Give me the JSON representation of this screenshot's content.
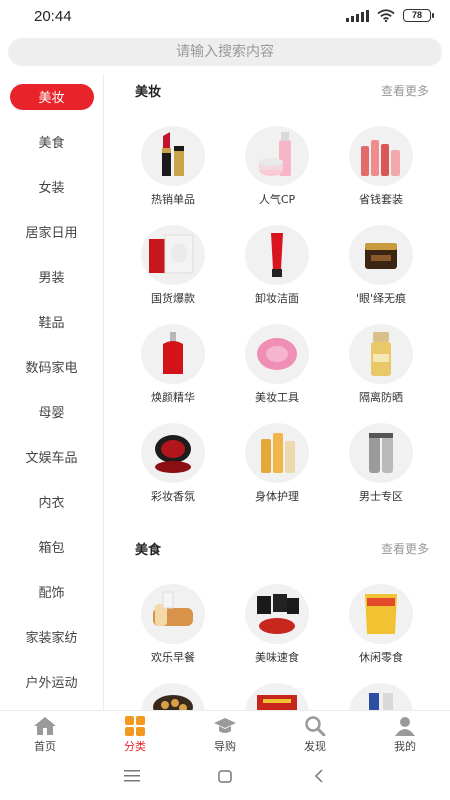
{
  "status": {
    "time": "20:44",
    "battery": "78"
  },
  "search": {
    "placeholder": "请输入搜索内容"
  },
  "sidebar": {
    "items": [
      {
        "label": "美妆",
        "active": true
      },
      {
        "label": "美食"
      },
      {
        "label": "女装"
      },
      {
        "label": "居家日用"
      },
      {
        "label": "男装"
      },
      {
        "label": "鞋品"
      },
      {
        "label": "数码家电"
      },
      {
        "label": "母婴"
      },
      {
        "label": "文娱车品"
      },
      {
        "label": "内衣"
      },
      {
        "label": "箱包"
      },
      {
        "label": "配饰"
      },
      {
        "label": "家装家纺"
      },
      {
        "label": "户外运动"
      }
    ]
  },
  "sections": [
    {
      "title": "美妆",
      "more": "查看更多",
      "items": [
        {
          "label": "热销单品",
          "icon": "lipstick-icon"
        },
        {
          "label": "人气CP",
          "icon": "skincare-bottles-icon"
        },
        {
          "label": "省钱套装",
          "icon": "skincare-set-icon"
        },
        {
          "label": "国货爆款",
          "icon": "face-mask-icon"
        },
        {
          "label": "卸妆洁面",
          "icon": "cleanser-tube-icon"
        },
        {
          "label": "'眼'绎无痕",
          "icon": "eye-cream-jar-icon"
        },
        {
          "label": "焕颜精华",
          "icon": "serum-bottle-icon"
        },
        {
          "label": "美妆工具",
          "icon": "face-brush-icon"
        },
        {
          "label": "隔离防晒",
          "icon": "sunscreen-icon"
        },
        {
          "label": "彩妆香氛",
          "icon": "cushion-compact-icon"
        },
        {
          "label": "身体护理",
          "icon": "body-care-bottles-icon"
        },
        {
          "label": "男士专区",
          "icon": "mens-care-icon"
        }
      ]
    },
    {
      "title": "美食",
      "more": "查看更多",
      "items": [
        {
          "label": "欢乐早餐",
          "icon": "bread-icon"
        },
        {
          "label": "美味速食",
          "icon": "instant-noodles-icon"
        },
        {
          "label": "休闲零食",
          "icon": "snack-bag-icon"
        },
        {
          "label": "",
          "icon": "cookies-icon"
        },
        {
          "label": "",
          "icon": "gift-box-icon"
        },
        {
          "label": "",
          "icon": "drinks-icon"
        }
      ]
    }
  ],
  "tabbar": {
    "items": [
      {
        "label": "首页",
        "icon": "home-icon"
      },
      {
        "label": "分类",
        "icon": "category-icon",
        "active": true
      },
      {
        "label": "导购",
        "icon": "graduation-cap-icon"
      },
      {
        "label": "发现",
        "icon": "search-icon"
      },
      {
        "label": "我的",
        "icon": "user-icon"
      }
    ]
  },
  "colors": {
    "accent": "#e8232a",
    "muted": "#999999",
    "thumb_bg": "#f1f1f1"
  }
}
